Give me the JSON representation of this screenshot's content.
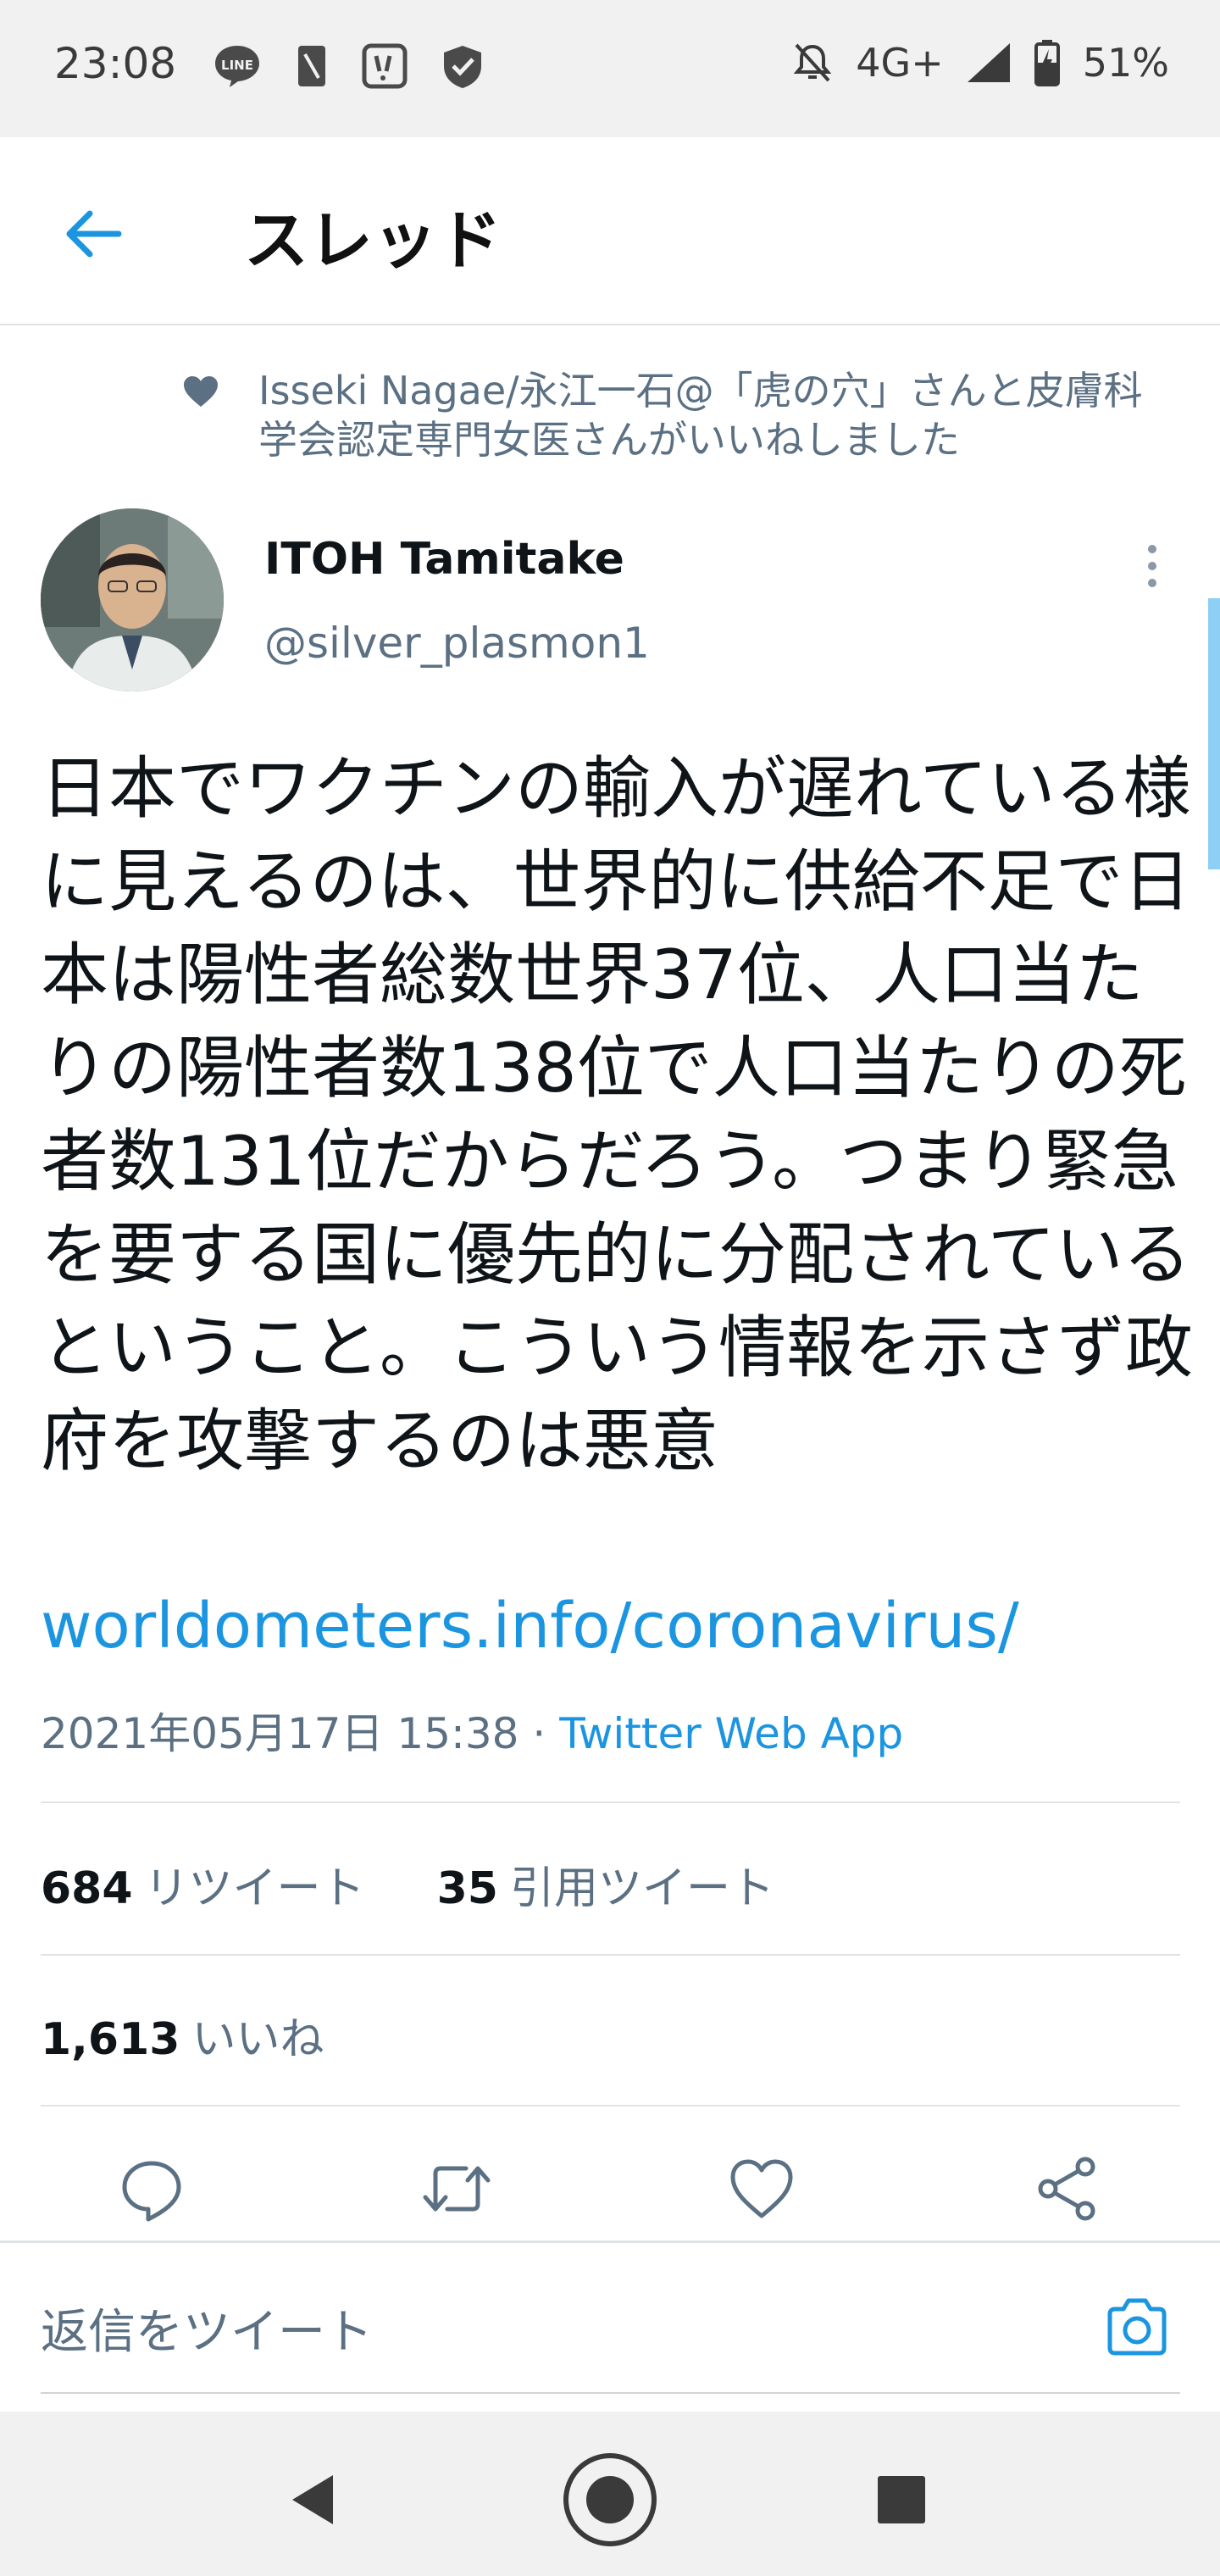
{
  "status_bar": {
    "time": "23:08",
    "left_icons": [
      "line-icon",
      "sim-icon",
      "notification-icon",
      "shield-icon"
    ],
    "network": "4G+",
    "battery": "51%"
  },
  "header": {
    "title": "スレッド"
  },
  "tweet": {
    "liked_by": "Isseki Nagae/永江一石@「虎の穴」さんと皮膚科学会認定専門女医さんがいいねしました",
    "author_name": "ITOH Tamitake",
    "author_handle": "@silver_plasmon1",
    "text": "日本でワクチンの輸入が遅れている様に見えるのは、世界的に供給不足で日本は陽性者総数世界37位、人口当たりの陽性者数138位で人口当たりの死者数131位だからだろう。つまり緊急を要する国に優先的に分配されているということ。こういう情報を示さず政府を攻撃するのは悪意",
    "link": "worldometers.info/coronavirus/",
    "timestamp": "2021年05月17日 15:38",
    "separator": "·",
    "source_app": "Twitter Web App"
  },
  "stats": {
    "retweets_count": "684",
    "retweets_label": "リツイート",
    "quotes_count": "35",
    "quotes_label": "引用ツイート",
    "likes_count": "1,613",
    "likes_label": "いいね"
  },
  "reply": {
    "placeholder": "返信をツイート"
  },
  "colors": {
    "accent": "#1b95e0",
    "secondary_text": "#5b7083",
    "primary_text": "#0f1419"
  }
}
